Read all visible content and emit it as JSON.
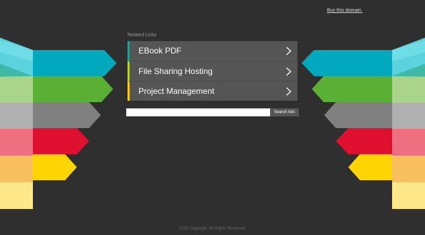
{
  "header": {
    "buy_link": "Buy this domain."
  },
  "related": {
    "title": "Related Links",
    "items": [
      {
        "label": "EBook PDF",
        "accent": "#2a9d8f"
      },
      {
        "label": "File Sharing Hosting",
        "accent": "#b5d335"
      },
      {
        "label": "Project Management",
        "accent": "#f5cb1f"
      }
    ]
  },
  "search": {
    "value": "",
    "button_label": "Search Ads"
  },
  "footer": {
    "copyright": "2020 Copyright. All Rights Reserved."
  },
  "colors": {
    "background": "#2f2f2f",
    "panel": "#555555",
    "arrows": [
      "#00a9bd",
      "#5ab035",
      "#808080",
      "#e01030",
      "#ffd400"
    ]
  },
  "icons": {
    "chevron": "chevron-right-icon"
  }
}
